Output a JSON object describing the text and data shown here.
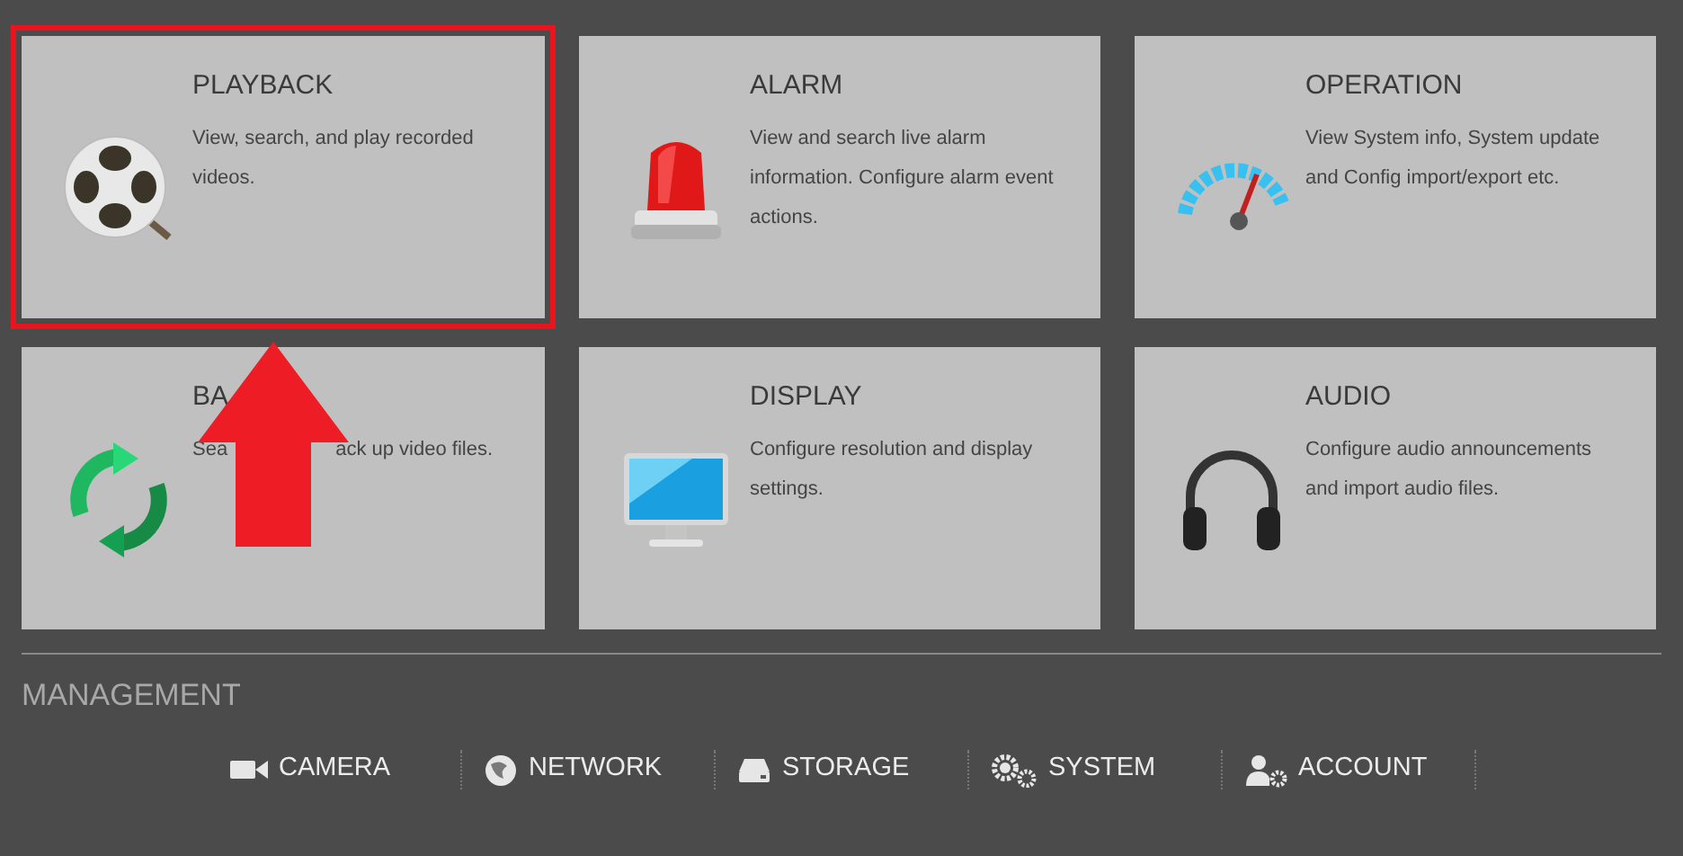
{
  "cards": [
    {
      "title": "PLAYBACK",
      "description": [
        "View, search, and play recorded videos."
      ],
      "highlighted": true
    },
    {
      "title": "ALARM",
      "description": [
        "View and search live alarm information. Configure alarm event actions."
      ],
      "highlighted": false
    },
    {
      "title": "OPERATION",
      "description": [
        "View System info, System update and Config import/export etc."
      ],
      "highlighted": false
    },
    {
      "title": "BA",
      "description": [
        "Sea",
        "ack up video files."
      ],
      "highlighted": false
    },
    {
      "title": "DISPLAY",
      "description": [
        "Configure resolution and display settings."
      ],
      "highlighted": false
    },
    {
      "title": "AUDIO",
      "description": [
        "Configure audio announcements and import audio files."
      ],
      "highlighted": false
    }
  ],
  "management": {
    "title": "MANAGEMENT",
    "items": [
      {
        "label": "CAMERA"
      },
      {
        "label": "NETWORK"
      },
      {
        "label": "STORAGE"
      },
      {
        "label": "SYSTEM"
      },
      {
        "label": "ACCOUNT"
      }
    ]
  }
}
